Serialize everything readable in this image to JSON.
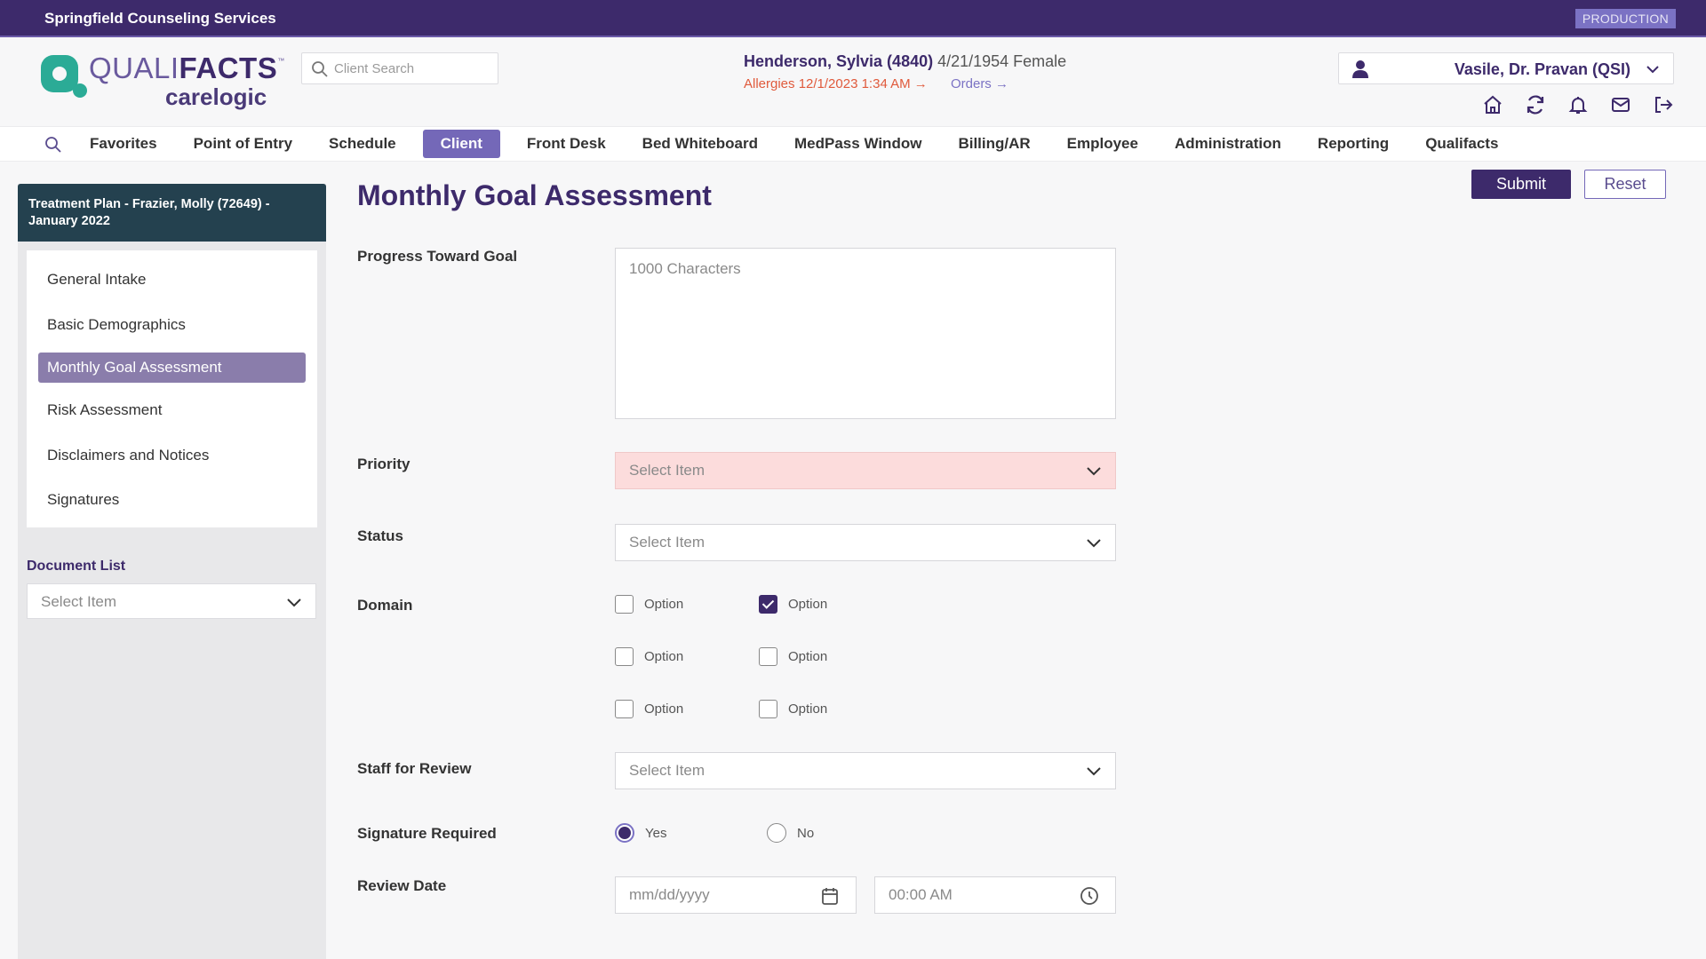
{
  "topbar": {
    "org_name": "Springfield Counseling Services",
    "environment_badge": "PRODUCTION"
  },
  "logo": {
    "brand_light": "QUALI",
    "brand_bold": "FACTS",
    "trademark": "™",
    "product": "carelogic"
  },
  "header": {
    "search_placeholder": "Client Search",
    "patient": {
      "name": "Henderson, Sylvia (4840)",
      "details": " 4/21/1954 Female",
      "allergies_link": "Allergies 12/1/2023 1:34 AM →",
      "orders_link": "Orders →"
    },
    "user": {
      "name": "Vasile, Dr. Pravan (QSI)"
    },
    "icons": [
      "home-icon",
      "refresh-icon",
      "bell-icon",
      "mail-icon",
      "logout-icon"
    ]
  },
  "nav": {
    "items": [
      {
        "label": "Favorites",
        "active": false
      },
      {
        "label": "Point of Entry",
        "active": false
      },
      {
        "label": "Schedule",
        "active": false
      },
      {
        "label": "Client",
        "active": true
      },
      {
        "label": "Front Desk",
        "active": false
      },
      {
        "label": "Bed Whiteboard",
        "active": false
      },
      {
        "label": "MedPass Window",
        "active": false
      },
      {
        "label": "Billing/AR",
        "active": false
      },
      {
        "label": "Employee",
        "active": false
      },
      {
        "label": "Administration",
        "active": false
      },
      {
        "label": "Reporting",
        "active": false
      },
      {
        "label": "Qualifacts",
        "active": false
      }
    ]
  },
  "sidebar": {
    "header": "Treatment Plan - Frazier, Molly (72649) - January 2022",
    "items": [
      {
        "label": "General Intake",
        "active": false
      },
      {
        "label": "Basic Demographics",
        "active": false
      },
      {
        "label": "Monthly Goal Assessment",
        "active": true
      },
      {
        "label": "Risk Assessment",
        "active": false
      },
      {
        "label": "Disclaimers and Notices",
        "active": false
      },
      {
        "label": "Signatures",
        "active": false
      }
    ],
    "document_list": {
      "label": "Document List",
      "value": "Select Item"
    }
  },
  "form": {
    "title": "Monthly Goal Assessment",
    "submit_label": "Submit",
    "reset_label": "Reset",
    "progress": {
      "label": "Progress Toward Goal",
      "placeholder": "1000 Characters",
      "value": ""
    },
    "priority": {
      "label": "Priority",
      "value": "Select Item",
      "error": true
    },
    "status": {
      "label": "Status",
      "value": "Select Item"
    },
    "domain": {
      "label": "Domain",
      "options": [
        {
          "label": "Option",
          "checked": false
        },
        {
          "label": "Option",
          "checked": true
        },
        {
          "label": "Option",
          "checked": false
        },
        {
          "label": "Option",
          "checked": false
        },
        {
          "label": "Option",
          "checked": false
        },
        {
          "label": "Option",
          "checked": false
        }
      ]
    },
    "staff_for_review": {
      "label": "Staff for Review",
      "value": "Select Item"
    },
    "signature_required": {
      "label": "Signature Required",
      "options": [
        {
          "label": "Yes",
          "selected": true
        },
        {
          "label": "No",
          "selected": false
        }
      ]
    },
    "review_date": {
      "label": "Review Date",
      "date_placeholder": "mm/dd/yyyy",
      "time_placeholder": "00:00 AM"
    }
  },
  "colors": {
    "brand_purple": "#3d2a6b",
    "accent_purple": "#7468b8",
    "brand_teal": "#2bab96",
    "sidebar_header": "#24414f",
    "error_bg": "#fcdcdc",
    "allergy_red": "#e05a3c"
  }
}
